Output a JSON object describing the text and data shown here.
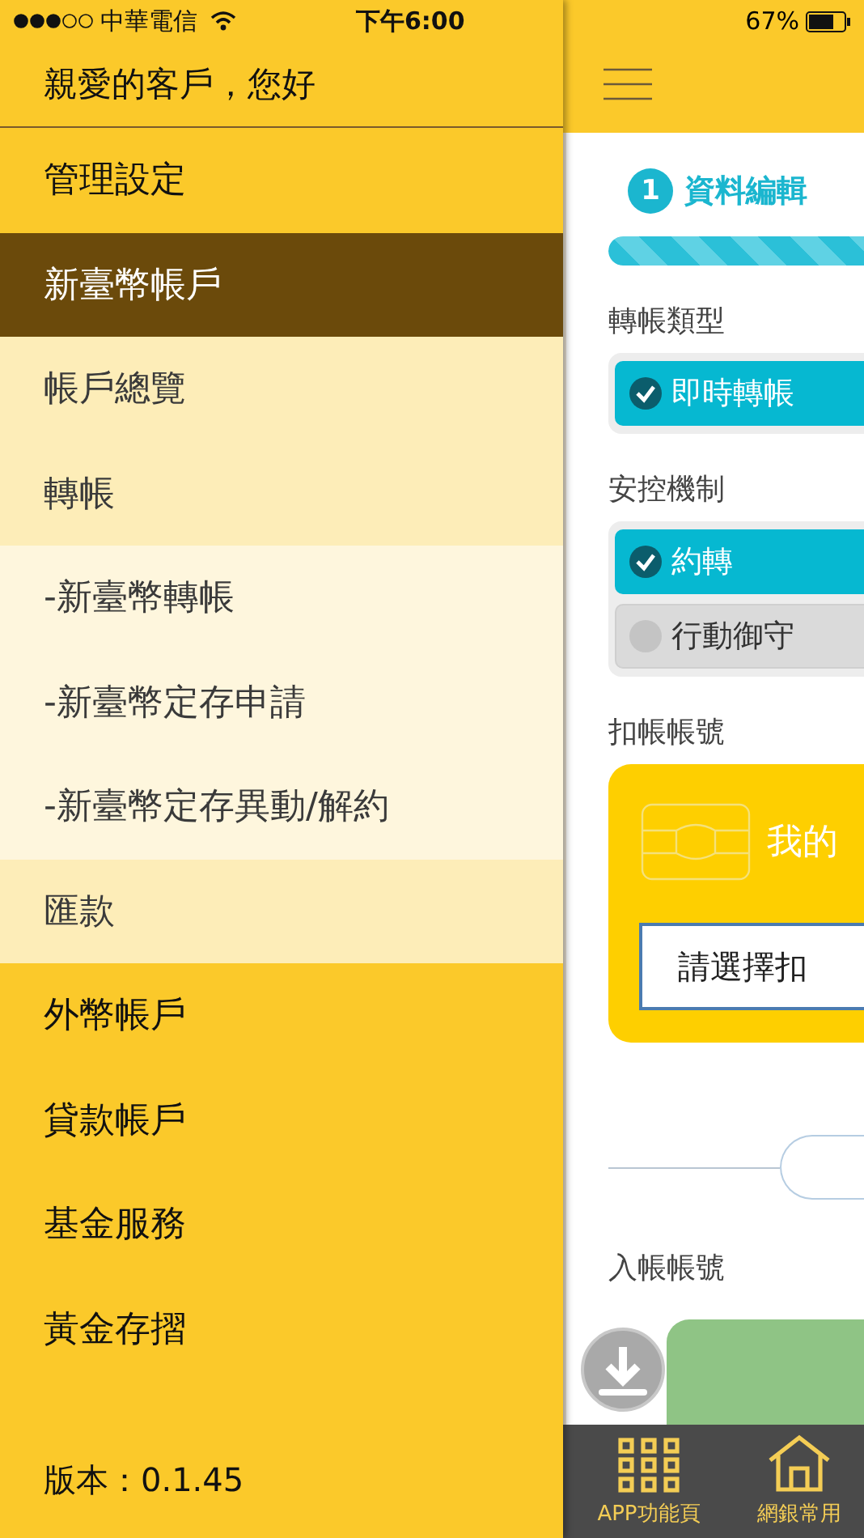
{
  "status_bar": {
    "carrier": "中華電信",
    "time": "下午6:00",
    "battery": "67%"
  },
  "drawer": {
    "greeting": "親愛的客戶，您好",
    "items": [
      {
        "label": "管理設定",
        "kind": "top",
        "selected": false
      },
      {
        "label": "新臺幣帳戶",
        "kind": "top",
        "selected": true
      },
      {
        "label": "帳戶總覽",
        "kind": "sub",
        "selected": false
      },
      {
        "label": "轉帳",
        "kind": "sub",
        "selected": false
      },
      {
        "label": "-新臺幣轉帳",
        "kind": "subsub",
        "selected": false
      },
      {
        "label": "-新臺幣定存申請",
        "kind": "subsub",
        "selected": false
      },
      {
        "label": "-新臺幣定存異動/解約",
        "kind": "subsub",
        "selected": false
      },
      {
        "label": "匯款",
        "kind": "sub",
        "selected": false
      },
      {
        "label": "外幣帳戶",
        "kind": "top",
        "selected": false
      },
      {
        "label": "貸款帳戶",
        "kind": "top",
        "selected": false
      },
      {
        "label": "基金服務",
        "kind": "top",
        "selected": false
      },
      {
        "label": "黃金存摺",
        "kind": "top",
        "selected": false
      }
    ],
    "version": "版本：0.1.45"
  },
  "content": {
    "step": {
      "number": "1",
      "title": "資料編輯"
    },
    "progress": {
      "level": 1
    },
    "sections": [
      {
        "label": "轉帳類型",
        "options": [
          {
            "label": "即時轉帳",
            "checked": true
          }
        ]
      },
      {
        "label": "安控機制",
        "options": [
          {
            "label": "約轉",
            "checked": true
          },
          {
            "label": "行動御守",
            "checked": false
          }
        ]
      }
    ],
    "debit": {
      "label": "扣帳帳號",
      "card_title": "我的",
      "select_value": "請選擇扣"
    },
    "credit": {
      "label": "入帳帳號"
    }
  },
  "bottom_nav": [
    {
      "label": "APP功能頁",
      "kind": "grid"
    },
    {
      "label": "網銀常用",
      "kind": "home"
    }
  ]
}
